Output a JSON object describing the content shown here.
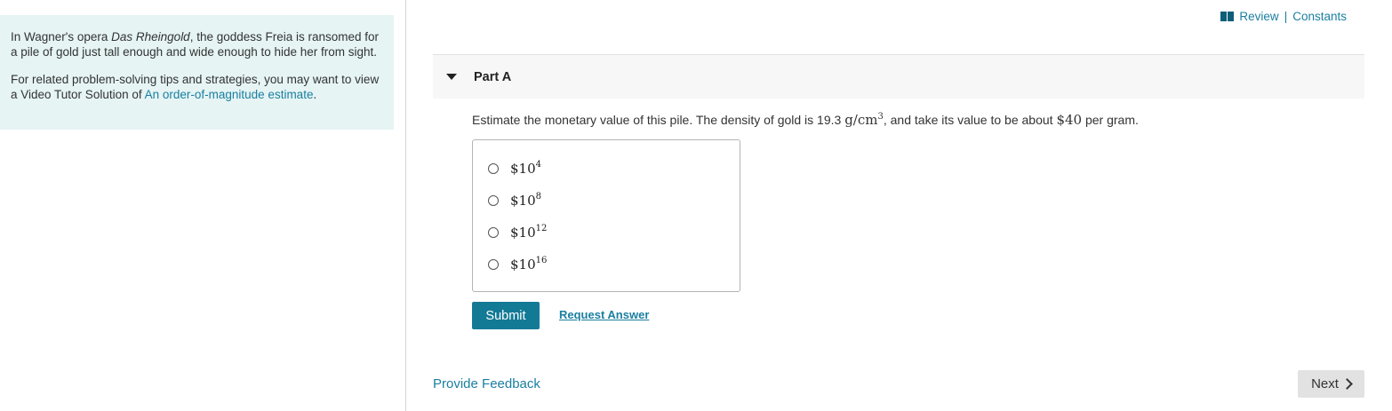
{
  "intro": {
    "p1_before": "In Wagner's opera ",
    "p1_italic": "Das Rheingold",
    "p1_after": ", the goddess Freia is ransomed for a pile of gold just tall enough and wide enough to hide her from sight.",
    "p2_before": "For related problem-solving tips and strategies, you may want to view a Video Tutor Solution of ",
    "p2_link": "An order-of-magnitude estimate",
    "p2_after": "."
  },
  "header": {
    "review": "Review",
    "separator": "|",
    "constants": "Constants"
  },
  "part": {
    "title": "Part A"
  },
  "question": {
    "before": "Estimate the monetary value of this pile. The density of gold is 19.3 ",
    "unit": "g/cm",
    "unit_exp": "3",
    "middle": ", and take its value to be about ",
    "price": "$40",
    "after": " per gram."
  },
  "choices": [
    {
      "base": "$10",
      "exp": "4"
    },
    {
      "base": "$10",
      "exp": "8"
    },
    {
      "base": "$10",
      "exp": "12"
    },
    {
      "base": "$10",
      "exp": "16"
    }
  ],
  "actions": {
    "submit": "Submit",
    "request_answer": "Request Answer",
    "provide_feedback": "Provide Feedback",
    "next": "Next"
  },
  "icons": {
    "review": "book-icon",
    "part_toggle": "caret-down-icon",
    "next": "chevron-right-icon"
  },
  "colors": {
    "accent": "#137a96",
    "link": "#1a7fa0",
    "intro_bg": "#e6f4f4"
  }
}
